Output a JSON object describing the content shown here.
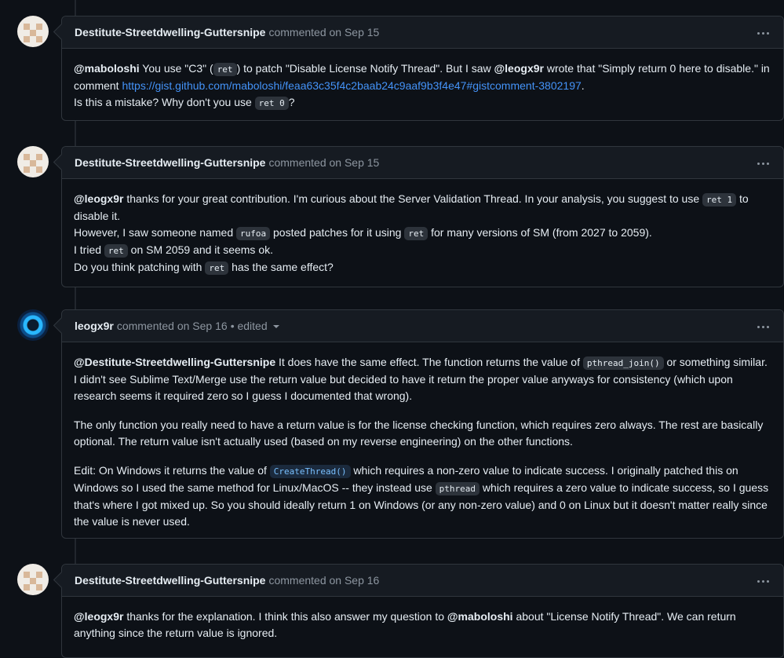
{
  "comments": [
    {
      "author": "Destitute-Streetdwelling-Guttersnipe",
      "meta": "commented on Sep 15",
      "edited": "",
      "p1": {
        "m1": "@maboloshi",
        "t1": " You use \"C3\" (",
        "c1": "ret",
        "t2": ") to patch \"Disable License Notify Thread\". But I saw ",
        "m2": "@leogx9r",
        "t3": " wrote that \"Simply return 0 here to disable.\" in comment ",
        "link": "https://gist.github.com/maboloshi/feaa63c35f4c2baab24c9aaf9b3f4e47#gistcomment-3802197",
        "t4": ".",
        "t5": "Is this a mistake? Why don't you use ",
        "c2": "ret 0",
        "t6": "?"
      }
    },
    {
      "author": "Destitute-Streetdwelling-Guttersnipe",
      "meta": "commented on Sep 15",
      "edited": "",
      "p1": {
        "m1": "@leogx9r",
        "t1": " thanks for your great contribution. I'm curious about the Server Validation Thread. In your analysis, you suggest to use ",
        "c1": "ret 1",
        "t2": " to disable it.",
        "t3": "However, I saw someone named ",
        "c2": "rufoa",
        "t4": " posted patches for it using ",
        "c3": "ret",
        "t5": " for many versions of SM (from 2027 to 2059).",
        "t6": "I tried ",
        "c4": "ret",
        "t7": " on SM 2059 and it seems ok.",
        "t8": "Do you think patching with ",
        "c5": "ret",
        "t9": " has the same effect?"
      }
    },
    {
      "author": "leogx9r",
      "meta": "commented on Sep 16",
      "edited": "• edited",
      "p1": {
        "m1": "@Destitute-Streetdwelling-Guttersnipe",
        "t1": " It does have the same effect. The function returns the value of ",
        "c1": "pthread_join()",
        "t2": " or something similar. I didn't see Sublime Text/Merge use the return value but decided to have it return the proper value anyways for consistency (which upon research seems it required zero so I guess I documented that wrong)."
      },
      "p2": "The only function you really need to have a return value is for the license checking function, which requires zero always. The rest are basically optional. The return value isn't actually used (based on my reverse engineering) on the other functions.",
      "p3": {
        "t1": "Edit: On Windows it returns the value of ",
        "c1": "CreateThread()",
        "t2": " which requires a non-zero value to indicate success. I originally patched this on Windows so I used the same method for Linux/MacOS -- they instead use ",
        "c2": "pthread",
        "t3": " which requires a zero value to indicate success, so I guess that's where I got mixed up. So you should ideally return 1 on Windows (or any non-zero value) and 0 on Linux but it doesn't matter really since the value is never used."
      }
    },
    {
      "author": "Destitute-Streetdwelling-Guttersnipe",
      "meta": "commented on Sep 16",
      "edited": "",
      "p1": {
        "m1": "@leogx9r",
        "t1": " thanks for the explanation. I think this also answer my question to ",
        "m2": "@maboloshi",
        "t2": " about \"License Notify Thread\". We can return anything since the return value is ignored."
      }
    }
  ],
  "icons": {
    "menu": "kebab-horizontal-icon",
    "dropdown": "triangle-down-icon"
  }
}
